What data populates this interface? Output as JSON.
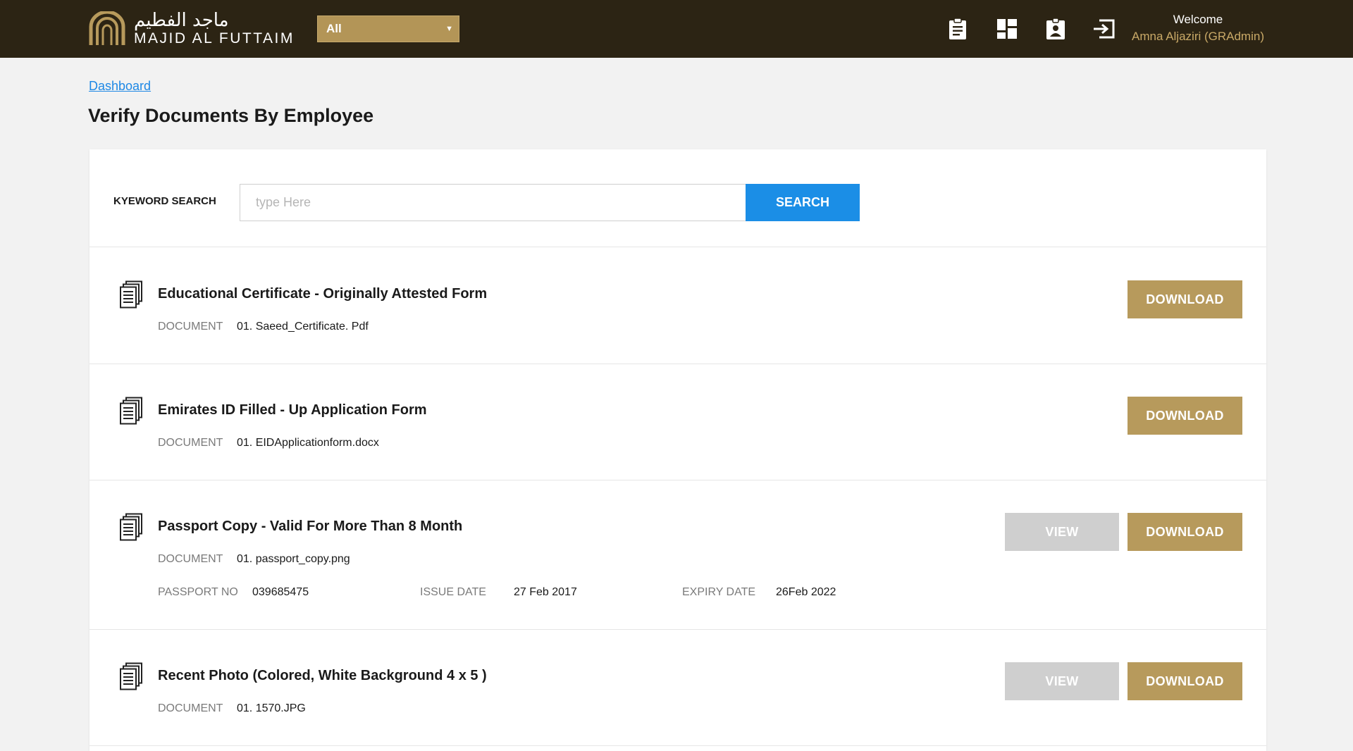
{
  "header": {
    "logo_arabic": "ماجد الفطيم",
    "logo_english": "MAJID AL FUTTAIM",
    "scope_select_value": "All",
    "icons": [
      "clipboard-icon",
      "dashboard-grid-icon",
      "id-badge-icon",
      "sign-out-icon"
    ],
    "welcome_label": "Welcome",
    "user_name": "Amna Aljaziri (GRAdmin)"
  },
  "breadcrumb": "Dashboard",
  "page_title": "Verify Documents By Employee",
  "search": {
    "label": "KYEWORD SEARCH",
    "placeholder": "type Here",
    "value": "",
    "button": "SEARCH"
  },
  "documents": [
    {
      "title": "Educational Certificate - Originally Attested Form",
      "doc_label": "DOCUMENT",
      "file": "01. Saeed_Certificate. Pdf",
      "download": "DOWNLOAD"
    },
    {
      "title": "Emirates ID Filled - Up Application Form",
      "doc_label": "DOCUMENT",
      "file": "01. EIDApplicationform.docx",
      "download": "DOWNLOAD"
    },
    {
      "title": "Passport Copy - Valid For More Than 8 Month",
      "doc_label": "DOCUMENT",
      "file": "01. passport_copy.png",
      "view": "VIEW",
      "download": "DOWNLOAD",
      "passport_no_label": "PASSPORT NO",
      "passport_no": "039685475",
      "issue_date_label": "ISSUE DATE",
      "issue_date": "27 Feb 2017",
      "expiry_date_label": "EXPIRY DATE",
      "expiry_date": "26Feb 2022"
    },
    {
      "title": "Recent Photo (Colored, White Background 4 x 5 )",
      "doc_label": "DOCUMENT",
      "file": "01. 1570.JPG",
      "view": "VIEW",
      "download": "DOWNLOAD"
    }
  ],
  "colors": {
    "header_bg": "#2c2414",
    "gold": "#b79a5c",
    "accent_blue": "#1b8ee6",
    "view_gray": "#cfcfcf"
  }
}
